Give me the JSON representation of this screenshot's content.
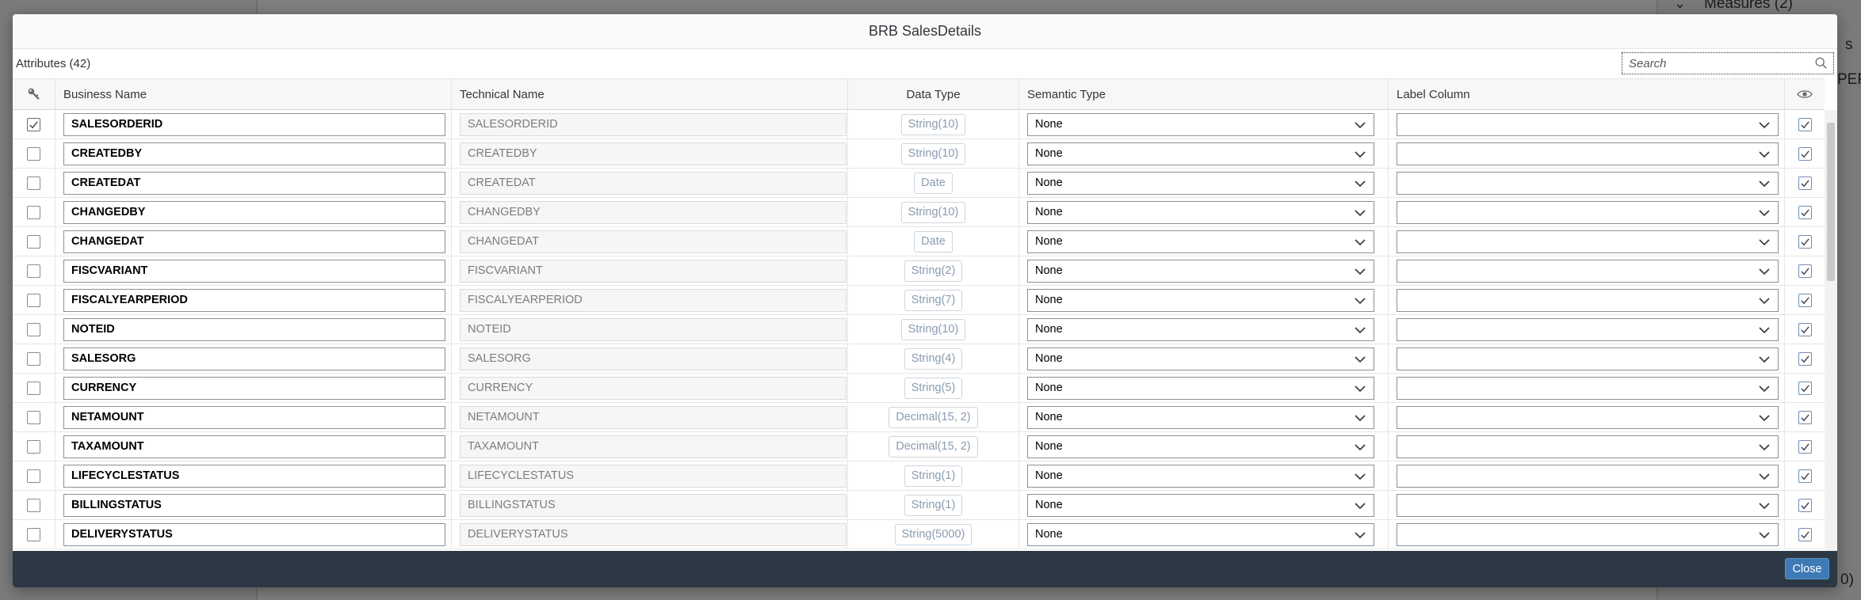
{
  "background": {
    "right_panel_items": [
      "Measures (2)",
      "s",
      "PERS",
      "0)"
    ]
  },
  "dialog": {
    "title": "BRB SalesDetails",
    "attributes_title": "Attributes (42)",
    "search": {
      "placeholder": "Search",
      "value": ""
    },
    "columns": {
      "key": "key-icon",
      "business_name": "Business Name",
      "technical_name": "Technical Name",
      "data_type": "Data Type",
      "semantic_type": "Semantic Type",
      "label_column": "Label Column",
      "visible": "eye-icon"
    },
    "rows": [
      {
        "key": true,
        "business_name": "SALESORDERID",
        "technical_name": "SALESORDERID",
        "data_type": "String(10)",
        "semantic_type": "None",
        "label_column": "",
        "visible": true
      },
      {
        "key": false,
        "business_name": "CREATEDBY",
        "technical_name": "CREATEDBY",
        "data_type": "String(10)",
        "semantic_type": "None",
        "label_column": "",
        "visible": true
      },
      {
        "key": false,
        "business_name": "CREATEDAT",
        "technical_name": "CREATEDAT",
        "data_type": "Date",
        "semantic_type": "None",
        "label_column": "",
        "visible": true
      },
      {
        "key": false,
        "business_name": "CHANGEDBY",
        "technical_name": "CHANGEDBY",
        "data_type": "String(10)",
        "semantic_type": "None",
        "label_column": "",
        "visible": true
      },
      {
        "key": false,
        "business_name": "CHANGEDAT",
        "technical_name": "CHANGEDAT",
        "data_type": "Date",
        "semantic_type": "None",
        "label_column": "",
        "visible": true
      },
      {
        "key": false,
        "business_name": "FISCVARIANT",
        "technical_name": "FISCVARIANT",
        "data_type": "String(2)",
        "semantic_type": "None",
        "label_column": "",
        "visible": true
      },
      {
        "key": false,
        "business_name": "FISCALYEARPERIOD",
        "technical_name": "FISCALYEARPERIOD",
        "data_type": "String(7)",
        "semantic_type": "None",
        "label_column": "",
        "visible": true
      },
      {
        "key": false,
        "business_name": "NOTEID",
        "technical_name": "NOTEID",
        "data_type": "String(10)",
        "semantic_type": "None",
        "label_column": "",
        "visible": true
      },
      {
        "key": false,
        "business_name": "SALESORG",
        "technical_name": "SALESORG",
        "data_type": "String(4)",
        "semantic_type": "None",
        "label_column": "",
        "visible": true
      },
      {
        "key": false,
        "business_name": "CURRENCY",
        "technical_name": "CURRENCY",
        "data_type": "String(5)",
        "semantic_type": "None",
        "label_column": "",
        "visible": true
      },
      {
        "key": false,
        "business_name": "NETAMOUNT",
        "technical_name": "NETAMOUNT",
        "data_type": "Decimal(15, 2)",
        "semantic_type": "None",
        "label_column": "",
        "visible": true
      },
      {
        "key": false,
        "business_name": "TAXAMOUNT",
        "technical_name": "TAXAMOUNT",
        "data_type": "Decimal(15, 2)",
        "semantic_type": "None",
        "label_column": "",
        "visible": true
      },
      {
        "key": false,
        "business_name": "LIFECYCLESTATUS",
        "technical_name": "LIFECYCLESTATUS",
        "data_type": "String(1)",
        "semantic_type": "None",
        "label_column": "",
        "visible": true
      },
      {
        "key": false,
        "business_name": "BILLINGSTATUS",
        "technical_name": "BILLINGSTATUS",
        "data_type": "String(1)",
        "semantic_type": "None",
        "label_column": "",
        "visible": true
      },
      {
        "key": false,
        "business_name": "DELIVERYSTATUS",
        "technical_name": "DELIVERYSTATUS",
        "data_type": "String(5000)",
        "semantic_type": "None",
        "label_column": "",
        "visible": true
      }
    ],
    "footer": {
      "close_label": "Close"
    }
  },
  "colors": {
    "overlay": "#7f7f7f",
    "footer": "#2c3843",
    "primary_button": "#3e7ab5",
    "datatype_text": "#8a9bb0"
  }
}
